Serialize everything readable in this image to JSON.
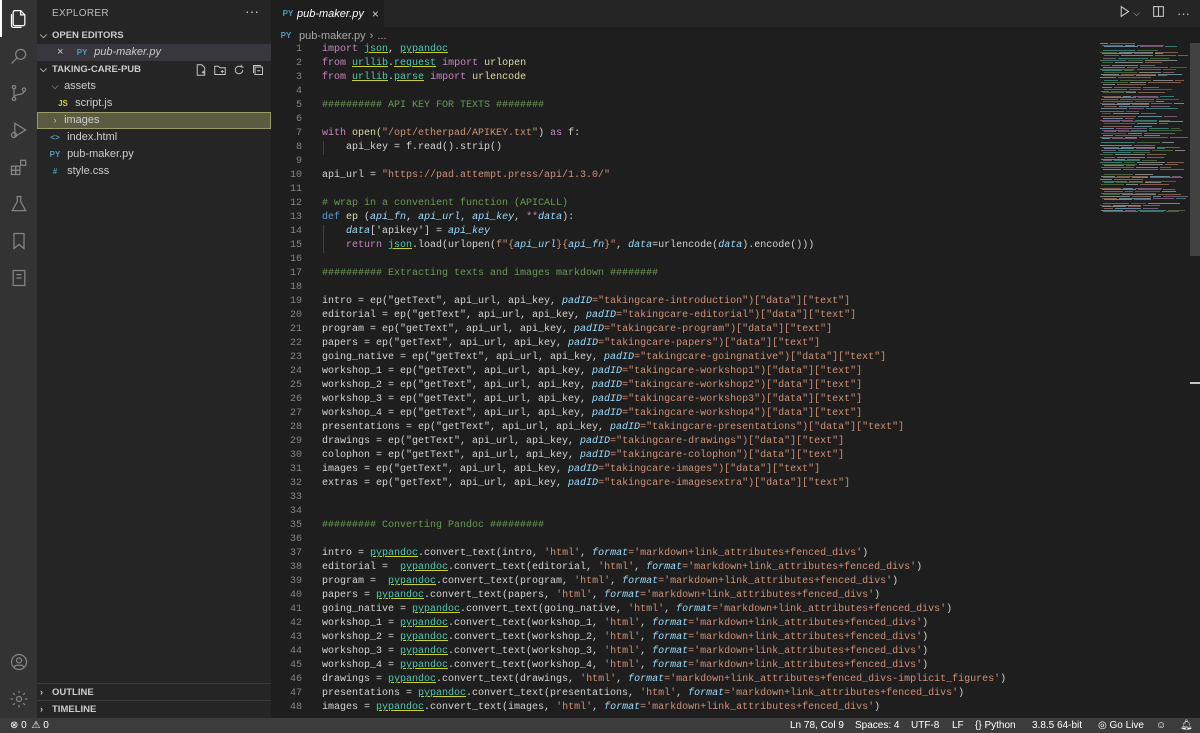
{
  "activity_bar": {
    "items": [
      {
        "name": "explorer",
        "icon": "files-icon"
      },
      {
        "name": "search",
        "icon": "search-icon"
      },
      {
        "name": "source-control",
        "icon": "source-control-icon"
      },
      {
        "name": "run-debug",
        "icon": "run-debug-icon"
      },
      {
        "name": "extensions",
        "icon": "extensions-icon"
      },
      {
        "name": "testing",
        "icon": "flask-icon"
      },
      {
        "name": "bookmarks",
        "icon": "bookmark-icon"
      },
      {
        "name": "notebook",
        "icon": "notebook-icon"
      }
    ],
    "bottom": [
      {
        "name": "accounts",
        "icon": "account-icon"
      },
      {
        "name": "manage",
        "icon": "gear-icon"
      }
    ]
  },
  "sidebar": {
    "title": "EXPLORER",
    "more": "···",
    "open_editors": {
      "label": "OPEN EDITORS",
      "files": [
        {
          "name": "pub-maker.py",
          "icon": "PY"
        }
      ]
    },
    "folder": {
      "label": "TAKING-CARE-PUB",
      "items": [
        {
          "name": "assets",
          "type": "folder",
          "expanded": true,
          "depth": 1
        },
        {
          "name": "script.js",
          "type": "file",
          "icon": "JS",
          "depth": 2
        },
        {
          "name": "images",
          "type": "folder",
          "expanded": false,
          "depth": 1
        },
        {
          "name": "index.html",
          "type": "file",
          "icon": "<>",
          "depth": 1
        },
        {
          "name": "pub-maker.py",
          "type": "file",
          "icon": "PY",
          "depth": 1
        },
        {
          "name": "style.css",
          "type": "file",
          "icon": "#",
          "depth": 1
        }
      ]
    },
    "outline_label": "OUTLINE",
    "timeline_label": "TIMELINE"
  },
  "tabs": [
    {
      "label": "pub-maker.py",
      "active": true,
      "icon": "PY",
      "close": "×"
    }
  ],
  "breadcrumb": {
    "file": "pub-maker.py",
    "sep": "›",
    "rest": "..."
  },
  "editor": {
    "start_line": 1,
    "lines": [
      [
        [
          "import ",
          "kw"
        ],
        [
          "json",
          "mod"
        ],
        [
          ", ",
          "p"
        ],
        [
          "pypandoc",
          "mod"
        ]
      ],
      [
        [
          "from ",
          "kw"
        ],
        [
          "urllib",
          "mod"
        ],
        [
          ".",
          "p"
        ],
        [
          "request",
          "mod"
        ],
        [
          " import ",
          "kw"
        ],
        [
          "urlopen",
          "fn"
        ]
      ],
      [
        [
          "from ",
          "kw"
        ],
        [
          "urllib",
          "mod"
        ],
        [
          ".",
          "p"
        ],
        [
          "parse",
          "mod"
        ],
        [
          " import ",
          "kw"
        ],
        [
          "urlencode",
          "fn"
        ]
      ],
      [],
      [
        [
          "########## API KEY FOR TEXTS ########",
          "cm"
        ]
      ],
      [],
      [
        [
          "with ",
          "kw"
        ],
        [
          "open(",
          "fn"
        ],
        [
          "\"/opt/etherpad/APIKEY.txt\"",
          "str"
        ],
        [
          ") ",
          "p"
        ],
        [
          "as ",
          "kw"
        ],
        [
          "f:",
          "p"
        ]
      ],
      [
        [
          "    api_key = f.read().strip()",
          "p"
        ]
      ],
      [],
      [
        [
          "api_url = ",
          "p"
        ],
        [
          "\"https://pad.attempt.press/api/1.3.0/\"",
          "str"
        ]
      ],
      [],
      [
        [
          "# wrap in a convenient function (APICALL)",
          "cm"
        ]
      ],
      [
        [
          "def ",
          "kw"
        ],
        [
          "ep ",
          "fn"
        ],
        [
          "(",
          "p"
        ],
        [
          "api_fn",
          "param"
        ],
        [
          ", ",
          "p"
        ],
        [
          "api_url",
          "param"
        ],
        [
          ", ",
          "p"
        ],
        [
          "api_key",
          "param"
        ],
        [
          ", ",
          "p"
        ],
        [
          "**",
          "kw"
        ],
        [
          "data",
          "param"
        ],
        [
          "):",
          "p"
        ]
      ],
      [
        [
          "    ",
          "p"
        ],
        [
          "data",
          "param"
        ],
        [
          "['apikey'] = ",
          "p"
        ],
        [
          "api_key",
          "param"
        ]
      ],
      [
        [
          "    ",
          "p"
        ],
        [
          "return ",
          "kw"
        ],
        [
          "json",
          "mod"
        ],
        [
          ".load(urlopen(",
          "p"
        ],
        [
          "f\"{",
          "str"
        ],
        [
          "api_url",
          "param"
        ],
        [
          "}{",
          "str"
        ],
        [
          "api_fn",
          "param"
        ],
        [
          "}\"",
          "str"
        ],
        [
          ", ",
          "p"
        ],
        [
          "data",
          "param"
        ],
        [
          "=urlencode(",
          "p"
        ],
        [
          "data",
          "param"
        ],
        [
          ").encode()))",
          "p"
        ]
      ],
      [],
      [
        [
          "########## Extracting texts and images markdown ########",
          "cm"
        ]
      ],
      [],
      [
        [
          "intro = ep(\"getText\", api_url, api_key, ",
          "p"
        ],
        [
          "padID",
          "param"
        ],
        [
          "=\"takingcare-introduction\")[\"data\"][\"text\"]",
          "str"
        ]
      ],
      [
        [
          "editorial = ep(\"getText\", api_url, api_key, ",
          "p"
        ],
        [
          "padID",
          "param"
        ],
        [
          "=\"takingcare-editorial\")[\"data\"][\"text\"]",
          "str"
        ]
      ],
      [
        [
          "program = ep(\"getText\", api_url, api_key, ",
          "p"
        ],
        [
          "padID",
          "param"
        ],
        [
          "=\"takingcare-program\")[\"data\"][\"text\"]",
          "str"
        ]
      ],
      [
        [
          "papers = ep(\"getText\", api_url, api_key, ",
          "p"
        ],
        [
          "padID",
          "param"
        ],
        [
          "=\"takingcare-papers\")[\"data\"][\"text\"]",
          "str"
        ]
      ],
      [
        [
          "going_native = ep(\"getText\", api_url, api_key, ",
          "p"
        ],
        [
          "padID",
          "param"
        ],
        [
          "=\"takingcare-goingnative\")[\"data\"][\"text\"]",
          "str"
        ]
      ],
      [
        [
          "workshop_1 = ep(\"getText\", api_url, api_key, ",
          "p"
        ],
        [
          "padID",
          "param"
        ],
        [
          "=\"takingcare-workshop1\")[\"data\"][\"text\"]",
          "str"
        ]
      ],
      [
        [
          "workshop_2 = ep(\"getText\", api_url, api_key, ",
          "p"
        ],
        [
          "padID",
          "param"
        ],
        [
          "=\"takingcare-workshop2\")[\"data\"][\"text\"]",
          "str"
        ]
      ],
      [
        [
          "workshop_3 = ep(\"getText\", api_url, api_key, ",
          "p"
        ],
        [
          "padID",
          "param"
        ],
        [
          "=\"takingcare-workshop3\")[\"data\"][\"text\"]",
          "str"
        ]
      ],
      [
        [
          "workshop_4 = ep(\"getText\", api_url, api_key, ",
          "p"
        ],
        [
          "padID",
          "param"
        ],
        [
          "=\"takingcare-workshop4\")[\"data\"][\"text\"]",
          "str"
        ]
      ],
      [
        [
          "presentations = ep(\"getText\", api_url, api_key, ",
          "p"
        ],
        [
          "padID",
          "param"
        ],
        [
          "=\"takingcare-presentations\")[\"data\"][\"text\"]",
          "str"
        ]
      ],
      [
        [
          "drawings = ep(\"getText\", api_url, api_key, ",
          "p"
        ],
        [
          "padID",
          "param"
        ],
        [
          "=\"takingcare-drawings\")[\"data\"][\"text\"]",
          "str"
        ]
      ],
      [
        [
          "colophon = ep(\"getText\", api_url, api_key, ",
          "p"
        ],
        [
          "padID",
          "param"
        ],
        [
          "=\"takingcare-colophon\")[\"data\"][\"text\"]",
          "str"
        ]
      ],
      [
        [
          "images = ep(\"getText\", api_url, api_key, ",
          "p"
        ],
        [
          "padID",
          "param"
        ],
        [
          "=\"takingcare-images\")[\"data\"][\"text\"]",
          "str"
        ]
      ],
      [
        [
          "extras = ep(\"getText\", api_url, api_key, ",
          "p"
        ],
        [
          "padID",
          "param"
        ],
        [
          "=\"takingcare-imagesextra\")[\"data\"][\"text\"]",
          "str"
        ]
      ],
      [],
      [],
      [
        [
          "######### Converting Pandoc #########",
          "cm"
        ]
      ],
      [],
      [
        [
          "intro = ",
          "p"
        ],
        [
          "pypandoc",
          "mod"
        ],
        [
          ".convert_text(intro, ",
          "p"
        ],
        [
          "'html'",
          "str"
        ],
        [
          ", ",
          "p"
        ],
        [
          "format",
          "param"
        ],
        [
          "='markdown+link_attributes+fenced_divs'",
          "str"
        ],
        [
          ")",
          "p"
        ]
      ],
      [
        [
          "editorial =  ",
          "p"
        ],
        [
          "pypandoc",
          "mod"
        ],
        [
          ".convert_text(editorial, ",
          "p"
        ],
        [
          "'html'",
          "str"
        ],
        [
          ", ",
          "p"
        ],
        [
          "format",
          "param"
        ],
        [
          "='markdown+link_attributes+fenced_divs'",
          "str"
        ],
        [
          ")",
          "p"
        ]
      ],
      [
        [
          "program =  ",
          "p"
        ],
        [
          "pypandoc",
          "mod"
        ],
        [
          ".convert_text(program, ",
          "p"
        ],
        [
          "'html'",
          "str"
        ],
        [
          ", ",
          "p"
        ],
        [
          "format",
          "param"
        ],
        [
          "='markdown+link_attributes+fenced_divs'",
          "str"
        ],
        [
          ")",
          "p"
        ]
      ],
      [
        [
          "papers = ",
          "p"
        ],
        [
          "pypandoc",
          "mod"
        ],
        [
          ".convert_text(papers, ",
          "p"
        ],
        [
          "'html'",
          "str"
        ],
        [
          ", ",
          "p"
        ],
        [
          "format",
          "param"
        ],
        [
          "='markdown+link_attributes+fenced_divs'",
          "str"
        ],
        [
          ")",
          "p"
        ]
      ],
      [
        [
          "going_native = ",
          "p"
        ],
        [
          "pypandoc",
          "mod"
        ],
        [
          ".convert_text(going_native, ",
          "p"
        ],
        [
          "'html'",
          "str"
        ],
        [
          ", ",
          "p"
        ],
        [
          "format",
          "param"
        ],
        [
          "='markdown+link_attributes+fenced_divs'",
          "str"
        ],
        [
          ")",
          "p"
        ]
      ],
      [
        [
          "workshop_1 = ",
          "p"
        ],
        [
          "pypandoc",
          "mod"
        ],
        [
          ".convert_text(workshop_1, ",
          "p"
        ],
        [
          "'html'",
          "str"
        ],
        [
          ", ",
          "p"
        ],
        [
          "format",
          "param"
        ],
        [
          "='markdown+link_attributes+fenced_divs'",
          "str"
        ],
        [
          ")",
          "p"
        ]
      ],
      [
        [
          "workshop_2 = ",
          "p"
        ],
        [
          "pypandoc",
          "mod"
        ],
        [
          ".convert_text(workshop_2, ",
          "p"
        ],
        [
          "'html'",
          "str"
        ],
        [
          ", ",
          "p"
        ],
        [
          "format",
          "param"
        ],
        [
          "='markdown+link_attributes+fenced_divs'",
          "str"
        ],
        [
          ")",
          "p"
        ]
      ],
      [
        [
          "workshop_3 = ",
          "p"
        ],
        [
          "pypandoc",
          "mod"
        ],
        [
          ".convert_text(workshop_3, ",
          "p"
        ],
        [
          "'html'",
          "str"
        ],
        [
          ", ",
          "p"
        ],
        [
          "format",
          "param"
        ],
        [
          "='markdown+link_attributes+fenced_divs'",
          "str"
        ],
        [
          ")",
          "p"
        ]
      ],
      [
        [
          "workshop_4 = ",
          "p"
        ],
        [
          "pypandoc",
          "mod"
        ],
        [
          ".convert_text(workshop_4, ",
          "p"
        ],
        [
          "'html'",
          "str"
        ],
        [
          ", ",
          "p"
        ],
        [
          "format",
          "param"
        ],
        [
          "='markdown+link_attributes+fenced_divs'",
          "str"
        ],
        [
          ")",
          "p"
        ]
      ],
      [
        [
          "drawings = ",
          "p"
        ],
        [
          "pypandoc",
          "mod"
        ],
        [
          ".convert_text(drawings, ",
          "p"
        ],
        [
          "'html'",
          "str"
        ],
        [
          ", ",
          "p"
        ],
        [
          "format",
          "param"
        ],
        [
          "='markdown+link_attributes+fenced_divs-implicit_figures'",
          "str"
        ],
        [
          ")",
          "p"
        ]
      ],
      [
        [
          "presentations = ",
          "p"
        ],
        [
          "pypandoc",
          "mod"
        ],
        [
          ".convert_text(presentations, ",
          "p"
        ],
        [
          "'html'",
          "str"
        ],
        [
          ", ",
          "p"
        ],
        [
          "format",
          "param"
        ],
        [
          "='markdown+link_attributes+fenced_divs'",
          "str"
        ],
        [
          ")",
          "p"
        ]
      ],
      [
        [
          "images = ",
          "p"
        ],
        [
          "pypandoc",
          "mod"
        ],
        [
          ".convert_text(images, ",
          "p"
        ],
        [
          "'html'",
          "str"
        ],
        [
          ", ",
          "p"
        ],
        [
          "format",
          "param"
        ],
        [
          "='markdown+link_attributes+fenced_divs'",
          "str"
        ],
        [
          ")",
          "p"
        ]
      ]
    ]
  },
  "status_bar": {
    "errors": "0",
    "warnings": "0",
    "position": "Ln 78, Col 9",
    "spaces": "Spaces: 4",
    "encoding": "UTF-8",
    "eol": "LF",
    "language": "Python",
    "interpreter": "3.8.5 64-bit",
    "live": "Go Live"
  },
  "colors": {
    "kw": "#c586c0",
    "mod": "#4ec9b0",
    "fn": "#dcdcaa",
    "str": "#ce9178",
    "cm": "#6a9955",
    "p": "#d4d4d4",
    "param": "#9cdcfe",
    "kwdef": "#569cd6"
  }
}
